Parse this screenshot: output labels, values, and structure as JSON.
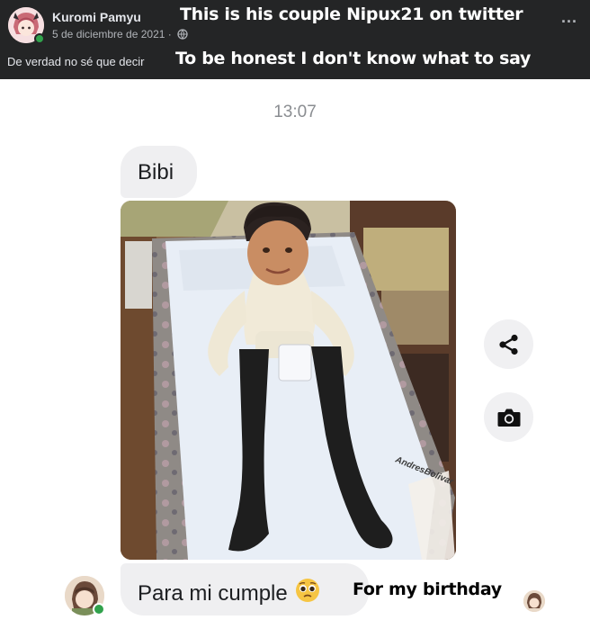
{
  "post": {
    "author": "Kuromi Pamyu",
    "date": "5 de diciembre de 2021 ·",
    "privacy_icon": "globe-icon",
    "more_icon": "more-options-icon",
    "more_label": "...",
    "text": "De verdad no sé que decir"
  },
  "captions": {
    "top": "This is his couple Nipux21 on twitter",
    "translation": "To be honest I don't know what to say",
    "birthday": "For my birthday"
  },
  "chat": {
    "time": "13:07",
    "messages": [
      {
        "text": "Bibi"
      },
      {
        "text": "Para mi cumple",
        "emoji": "pleading-face-emoji"
      }
    ],
    "photo_watermark": "AndresBolivar",
    "actions": [
      {
        "icon": "share-icon"
      },
      {
        "icon": "camera-icon"
      }
    ]
  },
  "colors": {
    "header_bg": "#242526",
    "bubble_bg": "#efeff1",
    "online": "#31a24c"
  }
}
